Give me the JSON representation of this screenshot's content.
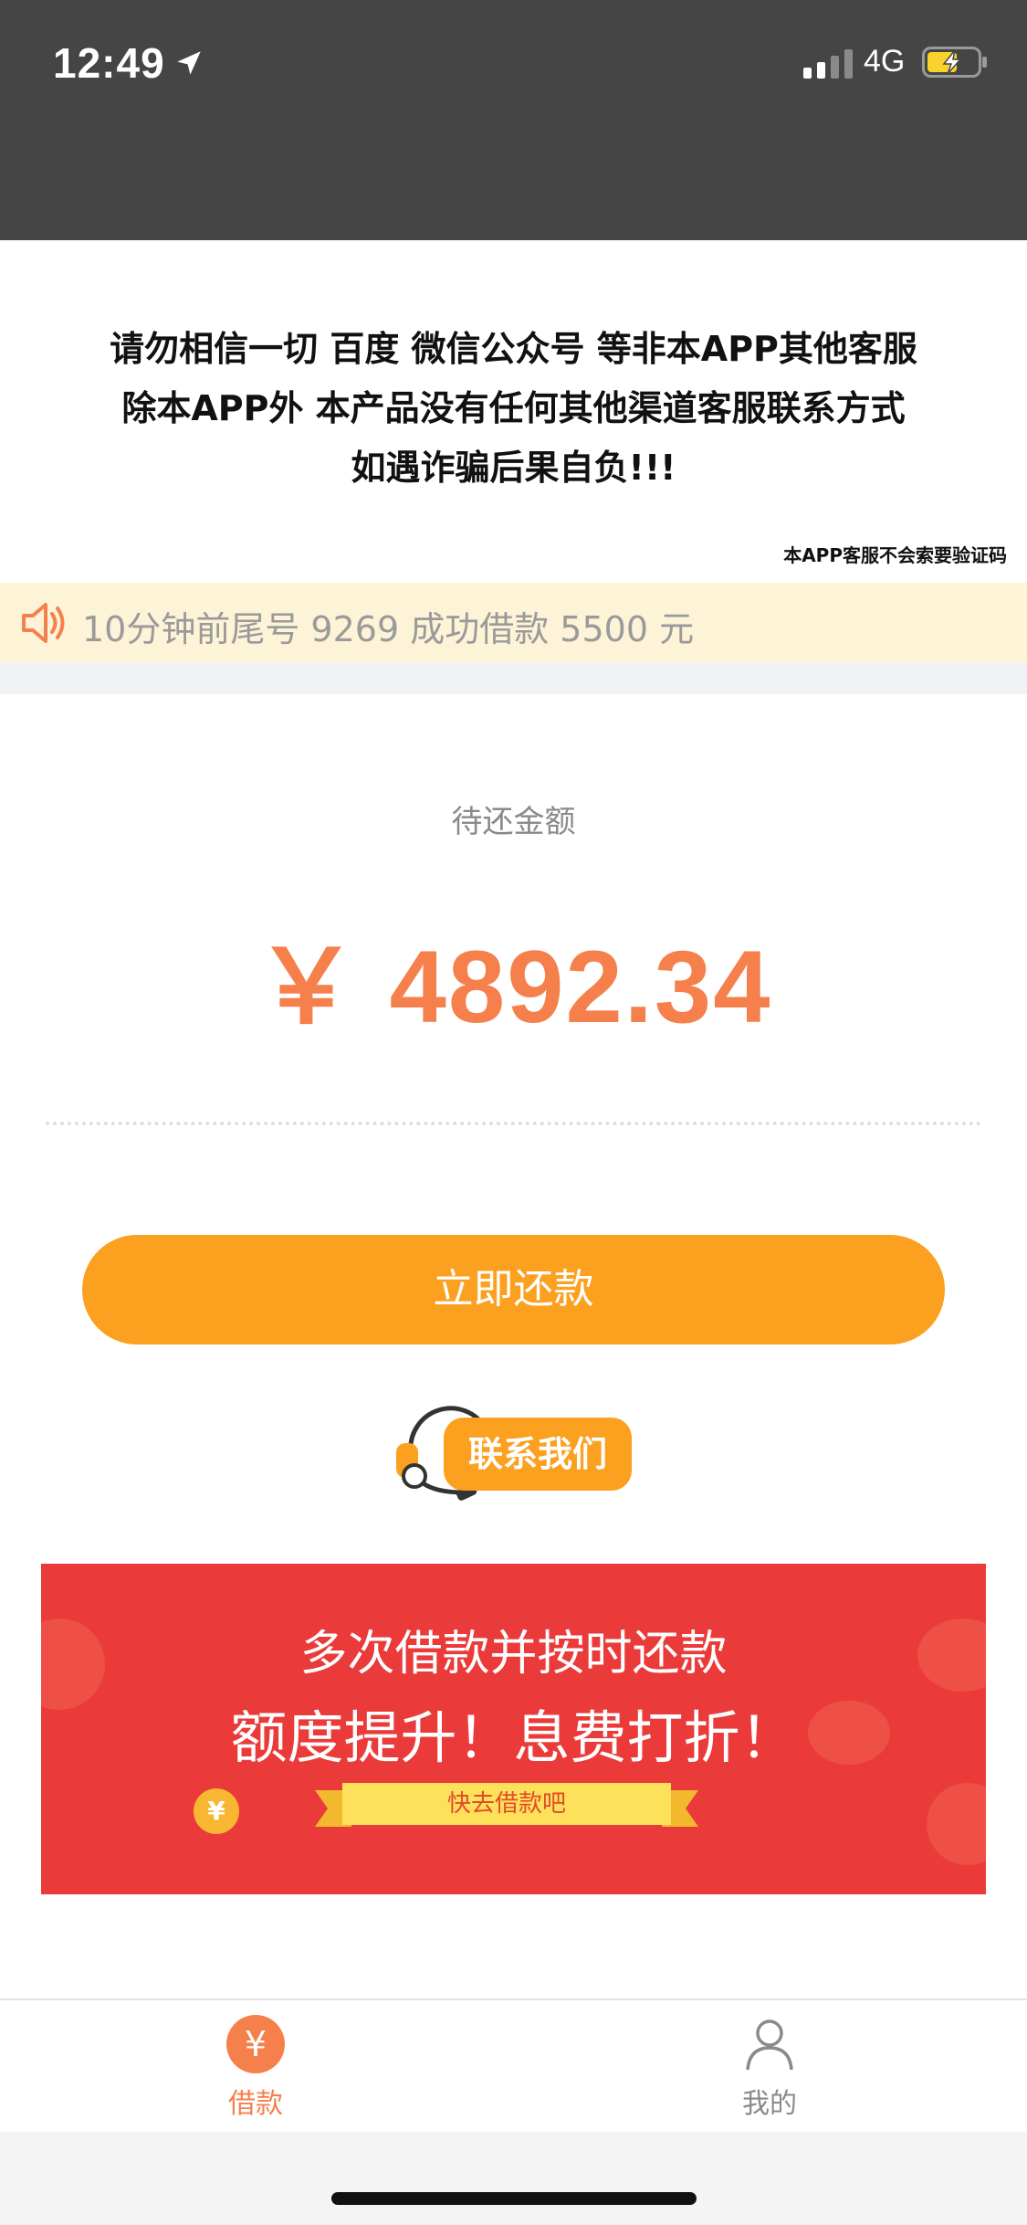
{
  "status_bar": {
    "time": "12:49",
    "network": "4G",
    "location_icon": "location-arrow-icon",
    "signal_icon": "signal-icon",
    "battery_icon": "battery-charging-icon"
  },
  "notice": {
    "line1": "请勿相信一切 百度 微信公众号 等非本APP其他客服",
    "line2": "除本APP外 本产品没有任何其他渠道客服联系方式",
    "line3": "如遇诈骗后果自负!!!",
    "small": "本APP客服不会索要验证码"
  },
  "marquee": {
    "icon": "speaker-icon",
    "text": "10分钟前尾号 9269 成功借款 5500 元"
  },
  "amount": {
    "label": "待还金额",
    "value": "￥ 4892.34"
  },
  "actions": {
    "repay_label": "立即还款",
    "contact_label": "联系我们",
    "contact_icon": "headset-icon"
  },
  "banner": {
    "line1": "多次借款并按时还款",
    "line2": "额度提升！息费打折！",
    "cta": "快去借款吧"
  },
  "tabbar": {
    "items": [
      {
        "label": "借款",
        "icon": "yuan-icon",
        "active": true
      },
      {
        "label": "我的",
        "icon": "user-icon",
        "active": false
      }
    ]
  },
  "colors": {
    "accent_orange": "#fca01f",
    "amount_orange": "#f5804c",
    "banner_red": "#ea3b3a",
    "header_gray": "#454545"
  }
}
